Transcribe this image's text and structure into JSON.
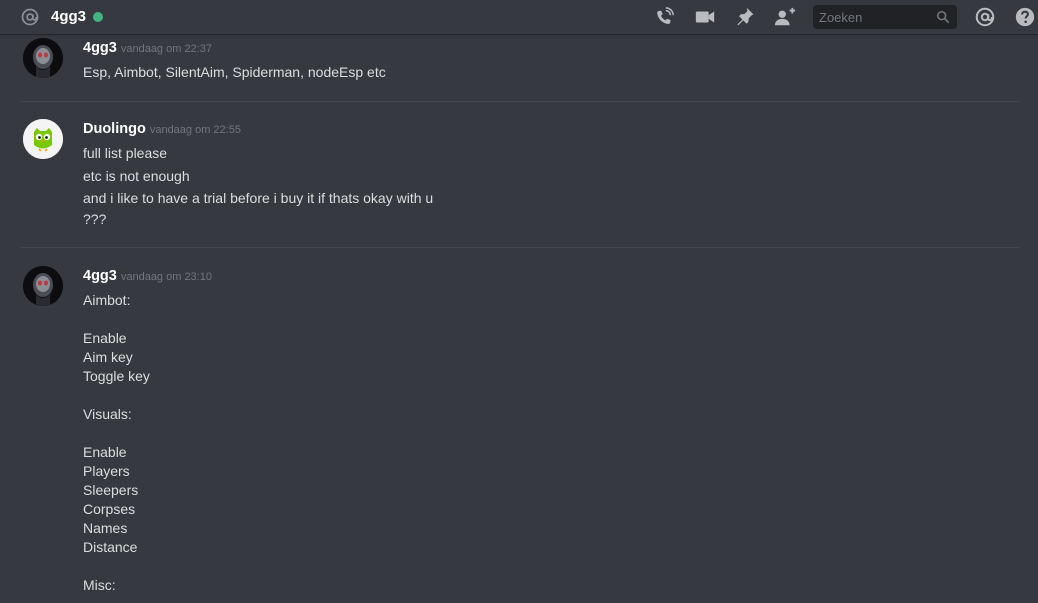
{
  "header": {
    "channel_name": "4gg3",
    "status_color": "#43b581",
    "icons": [
      "at-icon",
      "call-icon",
      "video-icon",
      "pin-icon",
      "add-member-icon",
      "search-icon",
      "mention-icon",
      "help-icon"
    ],
    "search": {
      "placeholder": "Zoeken"
    }
  },
  "messages": [
    {
      "author": "4gg3",
      "timestamp": "vandaag om 22:37",
      "lines": [
        "Esp, Aimbot, SilentAim, Spiderman, nodeEsp etc"
      ]
    },
    {
      "author": "Duolingo",
      "timestamp": "vandaag om 22:55",
      "lines": [
        "full list please",
        "etc is not enough",
        "and i like to have a trial before i buy it if thats okay with u",
        "???"
      ]
    },
    {
      "author": "4gg3",
      "timestamp": "vandaag om 23:10",
      "lines": [
        "Aimbot:",
        "",
        "Enable",
        "Aim key",
        "Toggle key",
        "",
        "Visuals:",
        "",
        "Enable",
        "Players",
        "Sleepers",
        "Corpses",
        "Names",
        "Distance",
        "",
        "Misc:"
      ]
    }
  ]
}
